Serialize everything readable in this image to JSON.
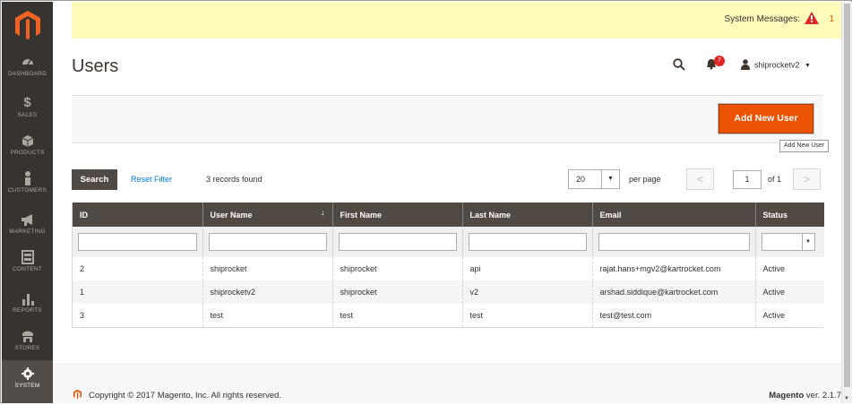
{
  "sidebar": {
    "items": [
      {
        "label": "DASHBOARD",
        "icon": "dashboard-icon"
      },
      {
        "label": "SALES",
        "icon": "dollar-icon"
      },
      {
        "label": "PRODUCTS",
        "icon": "cube-icon"
      },
      {
        "label": "CUSTOMERS",
        "icon": "person-icon"
      },
      {
        "label": "MARKETING",
        "icon": "megaphone-icon"
      },
      {
        "label": "CONTENT",
        "icon": "layout-icon"
      },
      {
        "label": "REPORTS",
        "icon": "bar-chart-icon"
      },
      {
        "label": "STORES",
        "icon": "store-icon"
      },
      {
        "label": "SYSTEM",
        "icon": "gear-icon"
      }
    ],
    "active": "SYSTEM"
  },
  "system_messages": {
    "label": "System Messages:",
    "count": "1"
  },
  "header": {
    "title": "Users",
    "notifications_count": "7",
    "username": "shiprocketv2"
  },
  "actions": {
    "add_new_user": "Add New User",
    "tooltip": "Add New User"
  },
  "toolbar": {
    "search": "Search",
    "reset_filter": "Reset Filter",
    "records_found": "3 records found",
    "per_page_value": "20",
    "per_page_label": "per page",
    "page_current": "1",
    "page_of": "of 1"
  },
  "grid": {
    "columns": [
      "ID",
      "User Name",
      "First Name",
      "Last Name",
      "Email",
      "Status"
    ],
    "rows": [
      {
        "id": "2",
        "username": "shiprocket",
        "first": "shiprocket",
        "last": "api",
        "email": "rajat.hans+mgv2@kartrocket.com",
        "status": "Active"
      },
      {
        "id": "1",
        "username": "shiprocketv2",
        "first": "shiprocket",
        "last": "v2",
        "email": "arshad.siddique@kartrocket.com",
        "status": "Active"
      },
      {
        "id": "3",
        "username": "test",
        "first": "test",
        "last": "test",
        "email": "test@test.com",
        "status": "Active"
      }
    ]
  },
  "footer": {
    "copyright": "Copyright © 2017 Magento, Inc. All rights reserved.",
    "brand": "Magento",
    "version": " ver. 2.1.7"
  },
  "colors": {
    "accent": "#eb5202",
    "sidebar": "#373330",
    "header_row": "#514943",
    "message_bar": "#fffbbb"
  }
}
